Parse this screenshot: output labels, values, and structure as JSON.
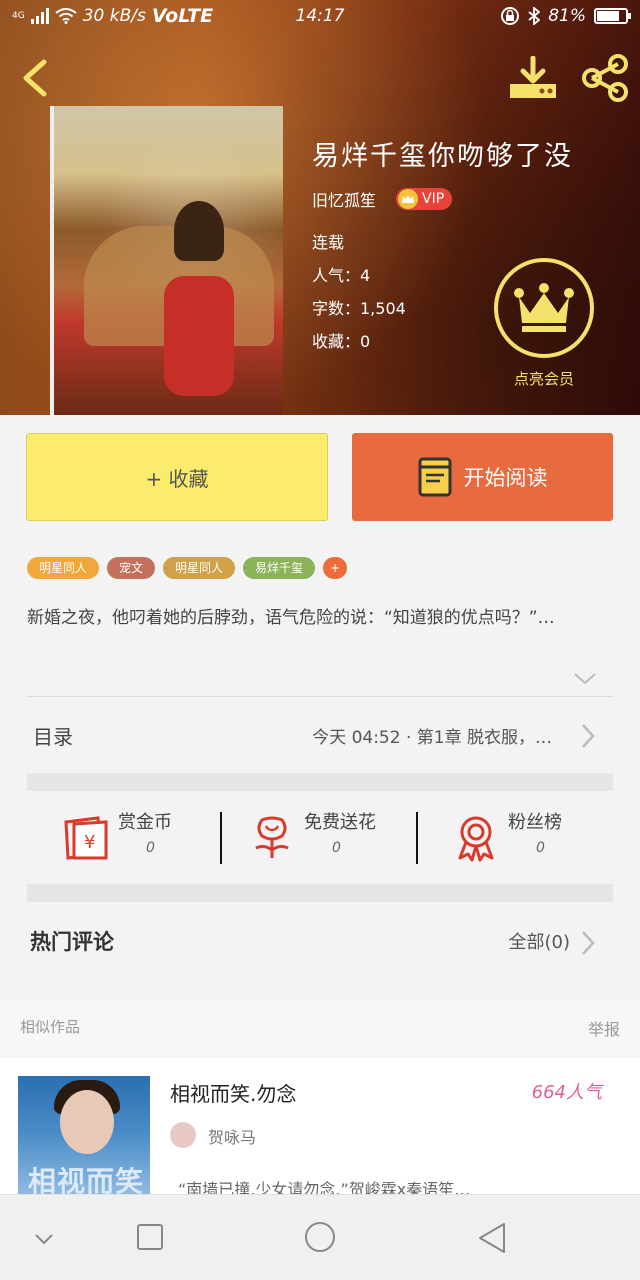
{
  "status_bar": {
    "network_type": "4G",
    "speed": "30 kB/s",
    "volte": "VoLTE",
    "time": "14:17",
    "battery": "81%",
    "battery_level": 0.81
  },
  "book": {
    "title": "易烊千玺你吻够了没",
    "author": "旧忆孤笙",
    "vip_label": "VIP",
    "status": "连载",
    "popularity": "人气：4",
    "word_count": "字数：1,504",
    "favorites": "收藏：0",
    "member_label": "点亮会员"
  },
  "actions": {
    "collect_label": "+ 收藏",
    "read_label": "开始阅读"
  },
  "tags": [
    {
      "label": "明星同人",
      "color": "#f0a83a"
    },
    {
      "label": "宠文",
      "color": "#c5705c"
    },
    {
      "label": "明星同人",
      "color": "#cfa24a"
    },
    {
      "label": "易烊千玺",
      "color": "#8bb35a"
    },
    {
      "label": "+",
      "color": "#ec6b3a"
    }
  ],
  "summary": "新婚之夜，他叼着她的后脖劲，语气危险的说：“知道狼的优点吗？”…",
  "toc": {
    "label": "目录",
    "latest": "今天 04:52 · 第1章 脱衣服，…"
  },
  "rewards": [
    {
      "name": "赏金币",
      "count": "0",
      "icon": "red-envelope-icon"
    },
    {
      "name": "免费送花",
      "count": "0",
      "icon": "flower-icon"
    },
    {
      "name": "粉丝榜",
      "count": "0",
      "icon": "medal-icon"
    }
  ],
  "comments": {
    "title": "热门评论",
    "all_label": "全部(0)"
  },
  "similar": {
    "label": "相似作品",
    "report_label": "举报",
    "items": [
      {
        "title": "相视而笑.勿念",
        "popularity": "664人气",
        "author": "贺咏马",
        "description": "“南墙已撞,少女请勿念.”贺峻霖x秦语笙…",
        "cover_text": "相视而笑"
      }
    ]
  },
  "colors": {
    "accent_orange": "#e86a3f",
    "collect_yellow": "#fbec6d",
    "member_gold": "#f4e26a",
    "popularity_pink": "#e45c9b"
  }
}
